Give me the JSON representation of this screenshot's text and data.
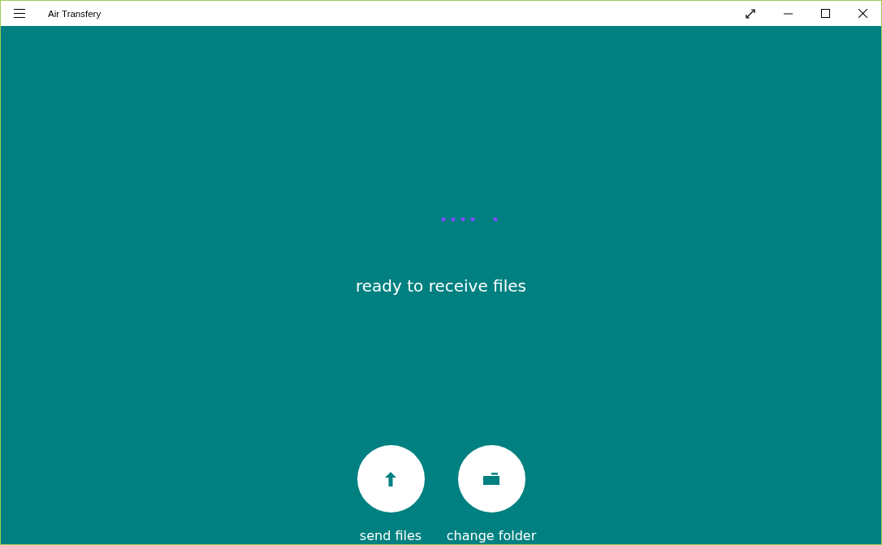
{
  "window": {
    "title": "Air Transfery"
  },
  "status": "ready to receive files",
  "actions": [
    {
      "kind": "send",
      "label": "send files"
    },
    {
      "kind": "folder",
      "label": "change folder"
    }
  ]
}
